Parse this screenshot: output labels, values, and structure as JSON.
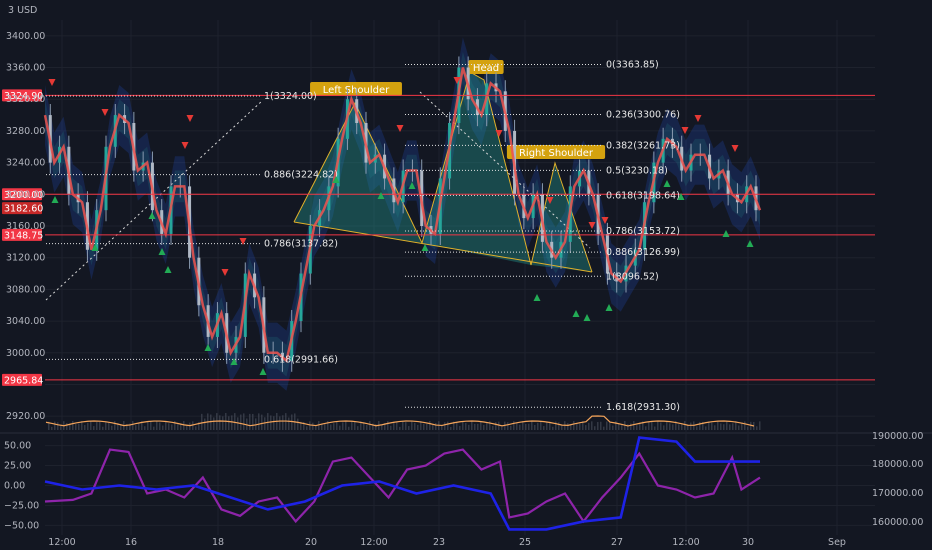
{
  "currency": "3 USD",
  "chart_data": {
    "type": "line",
    "title": "",
    "price_axis": {
      "range": [
        2900,
        3420
      ],
      "ticks": [
        3400,
        3360,
        3320,
        3280,
        3240,
        3200,
        3160,
        3120,
        3080,
        3040,
        3000,
        2960,
        2920
      ],
      "labels": [
        "3400.00",
        "3360.00",
        "3320.00",
        "3280.00",
        "3240.00",
        "3200.00",
        "3160.00",
        "3120.00",
        "3080.00",
        "3040.00",
        "3000.00",
        "",
        "2920.00"
      ]
    },
    "time_axis": {
      "labels": [
        "12:00",
        "16",
        "18",
        "20",
        "12:00",
        "23",
        "25",
        "27",
        "12:00",
        "30",
        "Sep"
      ]
    },
    "price_series": {
      "name": "",
      "points": [
        [
          0,
          3300
        ],
        [
          1,
          3240
        ],
        [
          2,
          3260
        ],
        [
          3,
          3200
        ],
        [
          4,
          3190
        ],
        [
          5,
          3130
        ],
        [
          6,
          3180
        ],
        [
          7,
          3260
        ],
        [
          8,
          3300
        ],
        [
          9,
          3290
        ],
        [
          10,
          3230
        ],
        [
          11,
          3240
        ],
        [
          12,
          3180
        ],
        [
          13,
          3150
        ],
        [
          14,
          3210
        ],
        [
          15,
          3210
        ],
        [
          16,
          3120
        ],
        [
          17,
          3060
        ],
        [
          18,
          3020
        ],
        [
          19,
          3050
        ],
        [
          20,
          3000
        ],
        [
          21,
          3020
        ],
        [
          22,
          3100
        ],
        [
          23,
          3070
        ],
        [
          24,
          3000
        ],
        [
          25,
          3000
        ],
        [
          26,
          2990
        ],
        [
          27,
          3040
        ],
        [
          28,
          3100
        ],
        [
          29,
          3160
        ],
        [
          30,
          3180
        ],
        [
          31,
          3210
        ],
        [
          32,
          3270
        ],
        [
          33,
          3320
        ],
        [
          34,
          3290
        ],
        [
          35,
          3240
        ],
        [
          36,
          3250
        ],
        [
          37,
          3220
        ],
        [
          38,
          3190
        ],
        [
          39,
          3230
        ],
        [
          40,
          3230
        ],
        [
          41,
          3160
        ],
        [
          42,
          3150
        ],
        [
          43,
          3220
        ],
        [
          44,
          3290
        ],
        [
          45,
          3360
        ],
        [
          46,
          3320
        ],
        [
          47,
          3300
        ],
        [
          48,
          3340
        ],
        [
          49,
          3330
        ],
        [
          50,
          3280
        ],
        [
          51,
          3200
        ],
        [
          52,
          3170
        ],
        [
          53,
          3200
        ],
        [
          54,
          3140
        ],
        [
          55,
          3120
        ],
        [
          56,
          3140
        ],
        [
          57,
          3210
        ],
        [
          58,
          3230
        ],
        [
          59,
          3200
        ],
        [
          60,
          3150
        ],
        [
          61,
          3100
        ],
        [
          62,
          3090
        ],
        [
          63,
          3110
        ],
        [
          64,
          3130
        ],
        [
          65,
          3190
        ],
        [
          66,
          3240
        ],
        [
          67,
          3270
        ],
        [
          68,
          3260
        ],
        [
          69,
          3230
        ],
        [
          70,
          3250
        ],
        [
          71,
          3250
        ],
        [
          72,
          3220
        ],
        [
          73,
          3230
        ],
        [
          74,
          3200
        ],
        [
          75,
          3190
        ],
        [
          76,
          3210
        ],
        [
          77,
          3180
        ]
      ]
    },
    "horizontal_levels": [
      {
        "value": 3324.9,
        "label": "3324.90"
      },
      {
        "value": 3200.0,
        "label": "3200.00"
      },
      {
        "value": 3182.6,
        "label": "3182.60"
      },
      {
        "value": 3148.75,
        "label": "3148.75"
      },
      {
        "value": 2965.84,
        "label": "2965.84"
      }
    ],
    "fib_left": [
      {
        "value": 3324.0,
        "label": "1(3324.00)"
      },
      {
        "value": 3224.82,
        "label": "0.886(3224.82)"
      },
      {
        "value": 3137.82,
        "label": "0.786(3137.82)"
      },
      {
        "value": 2991.66,
        "label": "0.618(2991.66)"
      }
    ],
    "fib_right": [
      {
        "value": 3363.85,
        "label": "0(3363.85)"
      },
      {
        "value": 3300.76,
        "label": "0.236(3300.76)"
      },
      {
        "value": 3261.73,
        "label": "0.382(3261.73)"
      },
      {
        "value": 3230.18,
        "label": "0.5(3230.18)"
      },
      {
        "value": 3198.64,
        "label": "0.618(3198.64)"
      },
      {
        "value": 3153.72,
        "label": "0.786(3153.72)"
      },
      {
        "value": 3126.99,
        "label": "0.886(3126.99)"
      },
      {
        "value": 3096.52,
        "label": "1(3096.52)"
      },
      {
        "value": 2931.3,
        "label": "1.618(2931.30)"
      }
    ],
    "pattern_labels": [
      "Left Shoulder",
      "Head",
      "Right Shoulder"
    ],
    "oscillator": {
      "ticks": [
        50,
        25,
        0,
        -25,
        -50
      ],
      "labels": [
        "50.00",
        "25.00",
        "0.00",
        "−25.00",
        "−50.00"
      ],
      "right_ticks": [
        190000,
        180000,
        170000,
        160000
      ],
      "right_labels": [
        "190000.00",
        "180000.00",
        "170000.00",
        "160000.00"
      ],
      "purple": [
        [
          0,
          -20
        ],
        [
          3,
          -18
        ],
        [
          5,
          -10
        ],
        [
          7,
          45
        ],
        [
          9,
          42
        ],
        [
          11,
          -10
        ],
        [
          13,
          -5
        ],
        [
          15,
          -15
        ],
        [
          17,
          10
        ],
        [
          19,
          -30
        ],
        [
          21,
          -38
        ],
        [
          23,
          -20
        ],
        [
          25,
          -15
        ],
        [
          27,
          -45
        ],
        [
          29,
          -20
        ],
        [
          31,
          30
        ],
        [
          33,
          35
        ],
        [
          35,
          10
        ],
        [
          37,
          -15
        ],
        [
          39,
          20
        ],
        [
          41,
          25
        ],
        [
          43,
          40
        ],
        [
          45,
          45
        ],
        [
          47,
          20
        ],
        [
          49,
          30
        ],
        [
          50,
          -40
        ],
        [
          52,
          -35
        ],
        [
          54,
          -20
        ],
        [
          56,
          -10
        ],
        [
          58,
          -45
        ],
        [
          60,
          -15
        ],
        [
          62,
          10
        ],
        [
          64,
          40
        ],
        [
          66,
          0
        ],
        [
          68,
          -5
        ],
        [
          70,
          -15
        ],
        [
          72,
          -10
        ],
        [
          74,
          35
        ],
        [
          75,
          -5
        ],
        [
          77,
          10
        ]
      ],
      "blue": [
        [
          0,
          5
        ],
        [
          4,
          -5
        ],
        [
          8,
          0
        ],
        [
          12,
          -5
        ],
        [
          16,
          0
        ],
        [
          20,
          -15
        ],
        [
          24,
          -30
        ],
        [
          28,
          -20
        ],
        [
          32,
          0
        ],
        [
          36,
          5
        ],
        [
          40,
          -10
        ],
        [
          44,
          0
        ],
        [
          48,
          -10
        ],
        [
          50,
          -55
        ],
        [
          54,
          -55
        ],
        [
          58,
          -45
        ],
        [
          62,
          -40
        ],
        [
          64,
          60
        ],
        [
          68,
          55
        ],
        [
          70,
          30
        ],
        [
          77,
          30
        ]
      ]
    }
  }
}
